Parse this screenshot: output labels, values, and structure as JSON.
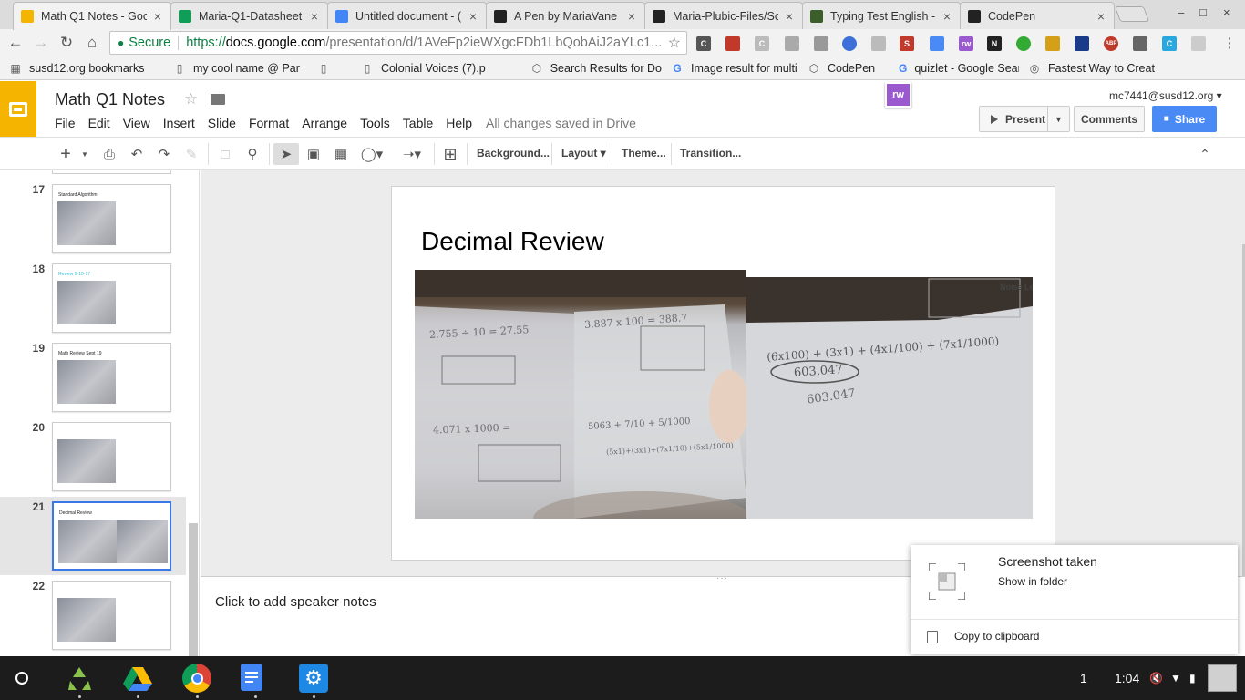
{
  "browser": {
    "tabs": [
      {
        "title": "Math Q1 Notes - Goo",
        "favicon": "google-slides",
        "color": "#f4b400",
        "active": true
      },
      {
        "title": "Maria-Q1-Datasheet",
        "favicon": "google-sheets",
        "color": "#0f9d58",
        "active": false
      },
      {
        "title": "Untitled document - (",
        "favicon": "google-docs",
        "color": "#4285f4",
        "active": false
      },
      {
        "title": "A Pen by MariaVane",
        "favicon": "codepen",
        "color": "#222222",
        "active": false
      },
      {
        "title": "Maria-Plubic-Files/Sc",
        "favicon": "github",
        "color": "#222222",
        "active": false
      },
      {
        "title": "Typing Test English -",
        "favicon": "typing-test",
        "color": "#3b5e2b",
        "active": false
      },
      {
        "title": "CodePen",
        "favicon": "codepen",
        "color": "#222222",
        "active": false
      }
    ],
    "omnibox": {
      "secure_label": "Secure",
      "scheme": "https://",
      "host": "docs.google.com",
      "path": "/presentation/d/1AVeFp2ieWXgcFDb1LbQobAiJ2aYLc1..."
    },
    "bookmarks": [
      {
        "label": "susd12.org bookmarks",
        "icon": "apps-icon"
      },
      {
        "label": "my cool name @ Par",
        "icon": "page-icon"
      },
      {
        "label": "",
        "icon": "page-icon"
      },
      {
        "label": "Colonial Voices (7).p",
        "icon": "page-icon"
      },
      {
        "label": "Search Results for Do",
        "icon": "codepen-icon"
      },
      {
        "label": "Image result for multi",
        "icon": "google-icon"
      },
      {
        "label": "CodePen",
        "icon": "codepen-icon"
      },
      {
        "label": "quizlet - Google Searc",
        "icon": "google-icon"
      },
      {
        "label": "Fastest Way to Creat",
        "icon": "spinner-icon"
      }
    ]
  },
  "slides_app": {
    "doc_title": "Math Q1 Notes",
    "menu": [
      "File",
      "Edit",
      "View",
      "Insert",
      "Slide",
      "Format",
      "Arrange",
      "Tools",
      "Table",
      "Help"
    ],
    "save_status": "All changes saved in Drive",
    "account": "mc7441@susd12.org",
    "rw_badge": "rw",
    "present_label": "Present",
    "comments_label": "Comments",
    "share_label": "Share",
    "toolbar": {
      "background": "Background...",
      "layout": "Layout",
      "theme": "Theme...",
      "transition": "Transition..."
    },
    "filmstrip": [
      {
        "number": "17",
        "title": "Standard Algorithm",
        "title_color": "#222222",
        "layout": "single"
      },
      {
        "number": "18",
        "title": "Review 9-10-17",
        "title_color": "#39c6d9",
        "layout": "single"
      },
      {
        "number": "19",
        "title": "Math Review Sept 19",
        "title_color": "#222222",
        "layout": "single"
      },
      {
        "number": "20",
        "title": "",
        "title_color": "#222222",
        "layout": "single"
      },
      {
        "number": "21",
        "title": "Decimal Review",
        "title_color": "#222222",
        "layout": "double",
        "selected": true
      },
      {
        "number": "22",
        "title": "",
        "title_color": "#222222",
        "layout": "single"
      }
    ],
    "current_slide": {
      "title": "Decimal Review",
      "left_photo_text": [
        "2.755 ÷ 10 = 27.55",
        "3.887 x 100 = 388.7",
        "4.071 x 1000 =",
        "5063 + 7/10 + 5/1000",
        "(5x1)+(3x1)+(7x1/10)+(5x1/1000)"
      ],
      "right_photo_text": [
        "(6x100) + (3x1) + (4x1/100) + (7x1/1000)",
        "603.047",
        "603.047",
        "Noise Le"
      ]
    },
    "speaker_notes_placeholder": "Click to add speaker notes"
  },
  "notification": {
    "title": "Screenshot taken",
    "action": "Show in folder",
    "secondary_action": "Copy to clipboard"
  },
  "shelf": {
    "apps": [
      "recycle-app",
      "google-drive",
      "google-chrome",
      "google-docs",
      "settings"
    ],
    "tray_number": "1",
    "time": "1:04"
  }
}
